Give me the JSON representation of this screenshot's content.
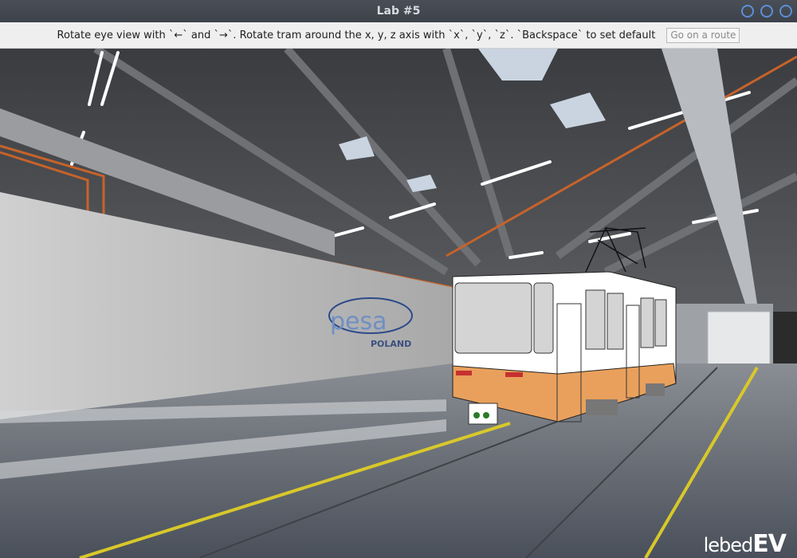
{
  "window": {
    "title": "Lab #5",
    "controls": [
      "minimize",
      "maximize",
      "close"
    ]
  },
  "toolbar": {
    "hint": "Rotate eye view with `←` and `→`. Rotate tram around the x, y, z axis with `x`, `y`, `z`. `Backspace` to set default",
    "route_button": "Go on a route",
    "route_button_enabled": false
  },
  "scene": {
    "wall_logo": "pesa",
    "wall_logo_sub": "POLAND",
    "floor_line_color": "#d8c82a",
    "tram_body_color": "#ffffff",
    "tram_stripe_color": "#e9a05c"
  },
  "watermark": {
    "prefix": "lebed",
    "suffix": "EV"
  }
}
